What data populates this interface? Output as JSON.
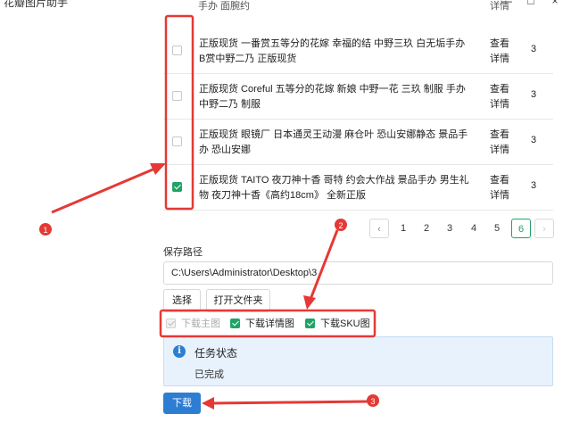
{
  "window": {
    "title": "花瓣图片助手",
    "controls": [
      "—",
      "□",
      "×"
    ]
  },
  "table": {
    "cut_title": "手办 面腕约",
    "cut_op": "详情",
    "rows": [
      {
        "checked": false,
        "title": "正版现货 一番赏五等分的花嫁 幸福的结 中野三玖 白无垢手办 B赏中野二乃 正版现货",
        "op": "查看详情",
        "qty": "3"
      },
      {
        "checked": false,
        "title": "正版现货 Coreful 五等分的花嫁 新娘 中野一花 三玖 制服 手办 中野二乃 制服",
        "op": "查看详情",
        "qty": "3"
      },
      {
        "checked": false,
        "title": "正版现货 眼镜厂 日本通灵王动漫 麻仓叶 恐山安娜静态 景品手办 恐山安娜",
        "op": "查看详情",
        "qty": "3"
      },
      {
        "checked": true,
        "title": "正版现货 TAITO 夜刀神十香 哥特 约会大作战 景品手办 男生礼物 夜刀神十香《高约18cm》 全新正版",
        "op": "查看详情",
        "qty": "3"
      }
    ]
  },
  "pagination": {
    "prev": "‹",
    "next": "›",
    "pages": [
      "1",
      "2",
      "3",
      "4",
      "5",
      "6"
    ],
    "active": "6"
  },
  "save": {
    "label": "保存路径",
    "path_value": "C:\\Users\\Administrator\\Desktop\\3",
    "select_button": "选择",
    "open_button": "打开文件夹"
  },
  "options": [
    {
      "label": "下载主图",
      "checked": true,
      "disabled": true
    },
    {
      "label": "下载详情图",
      "checked": true,
      "disabled": false
    },
    {
      "label": "下载SKU图",
      "checked": true,
      "disabled": false
    }
  ],
  "status": {
    "icon": "info-icon",
    "title": "任务状态",
    "text": "已完成"
  },
  "download_button": "下载",
  "annotations": [
    "1",
    "2",
    "3"
  ],
  "colors": {
    "accent_green": "#21a366",
    "primary_blue": "#2d7dd2",
    "annotation_red": "#e53935",
    "status_bg": "#e8f2fc"
  }
}
